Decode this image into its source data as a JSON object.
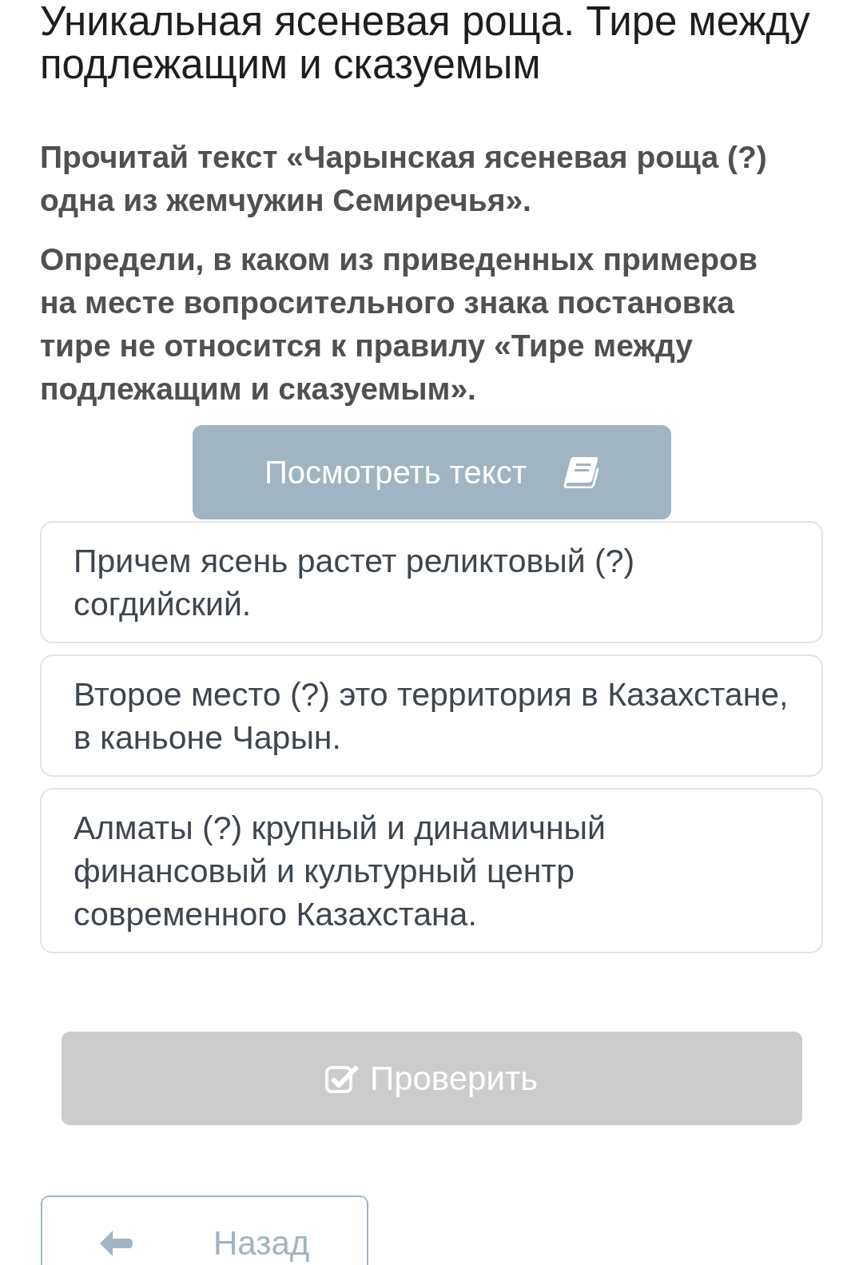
{
  "lesson_title": "Уникальная ясеневая роща. Тире между подлежащим и сказуемым",
  "instructions": [
    "Прочитай текст «Чарынская ясеневая роща (?) одна из жемчужин Семиречья».",
    "Определи, в каком из приведенных примеров на месте вопросительного знака постановка тире не относится к правилу «Тире между подлежащим и сказуемым»."
  ],
  "view_text_button": {
    "label": "Посмотреть текст"
  },
  "options": [
    {
      "text": "Причем ясень растет реликтовый (?) согдийский.",
      "selected": false
    },
    {
      "text": "Второе место (?) это территория в Казахстане, в каньоне Чарын.",
      "selected": false
    },
    {
      "text": "Алматы (?) крупный и динамичный финансовый и культурный центр современного Казахстана.",
      "selected": false
    }
  ],
  "check_button": {
    "label": "Проверить",
    "disabled": true
  },
  "back_button": {
    "label": "Назад"
  }
}
